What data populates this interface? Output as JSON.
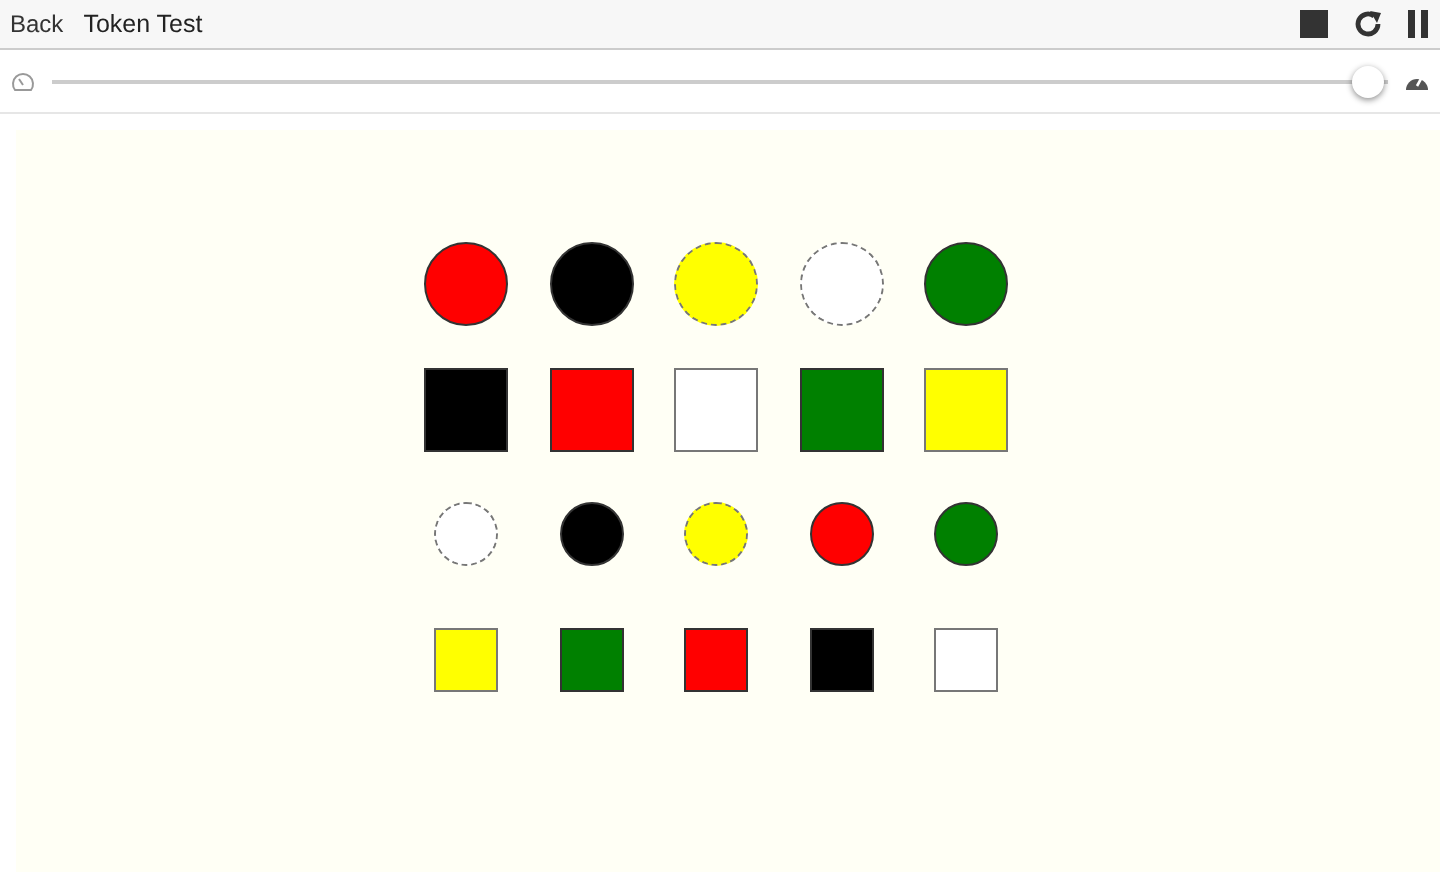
{
  "header": {
    "back": "Back",
    "title": "Token Test"
  },
  "speed": {
    "level": 0.985
  },
  "tokens": [
    [
      {
        "kind": "large_circle",
        "color": "#ff0000"
      },
      {
        "kind": "large_circle",
        "color": "#000000"
      },
      {
        "kind": "large_circle",
        "color": "#ffff00"
      },
      {
        "kind": "large_circle",
        "color": "#ffffff"
      },
      {
        "kind": "large_circle",
        "color": "#008000"
      }
    ],
    [
      {
        "kind": "large_square",
        "color": "#000000"
      },
      {
        "kind": "large_square",
        "color": "#ff0000"
      },
      {
        "kind": "large_square",
        "color": "#ffffff"
      },
      {
        "kind": "large_square",
        "color": "#008000"
      },
      {
        "kind": "large_square",
        "color": "#ffff00"
      }
    ],
    [
      {
        "kind": "small_circle",
        "color": "#ffffff"
      },
      {
        "kind": "small_circle",
        "color": "#000000"
      },
      {
        "kind": "small_circle",
        "color": "#ffff00"
      },
      {
        "kind": "small_circle",
        "color": "#ff0000"
      },
      {
        "kind": "small_circle",
        "color": "#008000"
      }
    ],
    [
      {
        "kind": "small_square",
        "color": "#ffff00"
      },
      {
        "kind": "small_square",
        "color": "#008000"
      },
      {
        "kind": "small_square",
        "color": "#ff0000"
      },
      {
        "kind": "small_square",
        "color": "#000000"
      },
      {
        "kind": "small_square",
        "color": "#ffffff"
      }
    ]
  ]
}
